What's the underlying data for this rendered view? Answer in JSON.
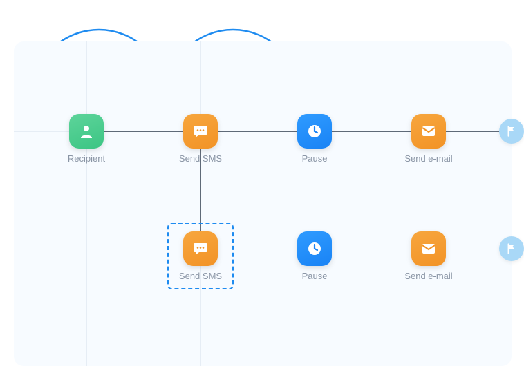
{
  "nodes": {
    "recipient": {
      "label": "Recipient",
      "color": "green",
      "icon": "person"
    },
    "sms1": {
      "label": "Send SMS",
      "color": "orange",
      "icon": "chat"
    },
    "pause1": {
      "label": "Pause",
      "color": "blue",
      "icon": "clock"
    },
    "email1": {
      "label": "Send e-mail",
      "color": "orange",
      "icon": "mail"
    },
    "sms2": {
      "label": "Send SMS",
      "color": "orange",
      "icon": "chat"
    },
    "pause2": {
      "label": "Pause",
      "color": "blue",
      "icon": "clock"
    },
    "email2": {
      "label": "Send e-mail",
      "color": "orange",
      "icon": "mail"
    }
  },
  "flags": {
    "flag1": {
      "icon": "flag"
    },
    "flag2": {
      "icon": "flag"
    }
  },
  "colors": {
    "green": "#3cc584",
    "orange": "#f29326",
    "blue": "#1983f5",
    "flagBg": "#a9d8f7",
    "arc": "#1e8bf0",
    "gridBg": "#f7fbff",
    "gridLine": "#e6edf5",
    "labelText": "#8a95a5",
    "connector": "#5f6a78"
  },
  "selection": {
    "target": "sms2"
  }
}
